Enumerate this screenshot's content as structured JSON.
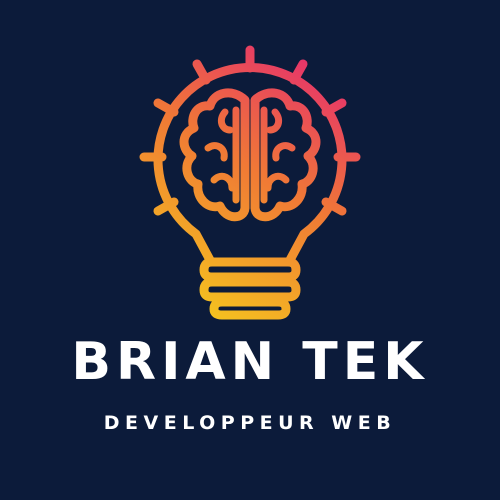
{
  "brand": {
    "name": "BRIAN TEK",
    "tagline": "DEVELOPPEUR WEB"
  },
  "logo": {
    "icon": "lightbulb-brain-icon",
    "gradient_start": "#e6336b",
    "gradient_mid": "#f07a35",
    "gradient_end": "#f5c61e"
  },
  "colors": {
    "background": "#0c1b3a",
    "text": "#ffffff"
  }
}
